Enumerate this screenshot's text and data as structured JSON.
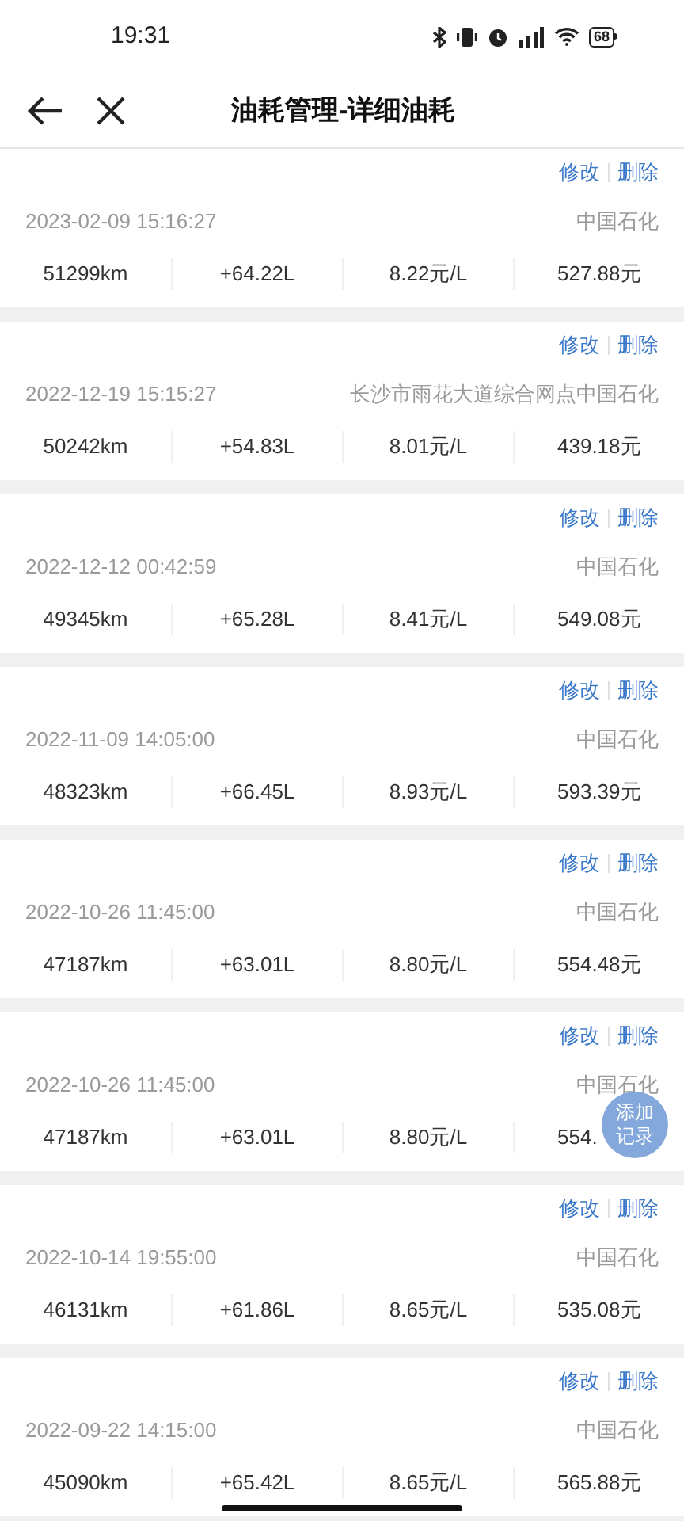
{
  "status_bar": {
    "time": "19:31",
    "battery": "68"
  },
  "nav": {
    "title": "油耗管理-详细油耗"
  },
  "records": [
    {
      "edit": "修改",
      "delete": "删除",
      "datetime": "2023-02-09 15:16:27",
      "station": "中国石化",
      "mileage": "51299km",
      "volume": "+64.22L",
      "price": "8.22元/L",
      "amount": "527.88元"
    },
    {
      "edit": "修改",
      "delete": "删除",
      "datetime": "2022-12-19 15:15:27",
      "station": "长沙市雨花大道综合网点中国石化",
      "mileage": "50242km",
      "volume": "+54.83L",
      "price": "8.01元/L",
      "amount": "439.18元"
    },
    {
      "edit": "修改",
      "delete": "删除",
      "datetime": "2022-12-12 00:42:59",
      "station": "中国石化",
      "mileage": "49345km",
      "volume": "+65.28L",
      "price": "8.41元/L",
      "amount": "549.08元"
    },
    {
      "edit": "修改",
      "delete": "删除",
      "datetime": "2022-11-09 14:05:00",
      "station": "中国石化",
      "mileage": "48323km",
      "volume": "+66.45L",
      "price": "8.93元/L",
      "amount": "593.39元"
    },
    {
      "edit": "修改",
      "delete": "删除",
      "datetime": "2022-10-26 11:45:00",
      "station": "中国石化",
      "mileage": "47187km",
      "volume": "+63.01L",
      "price": "8.80元/L",
      "amount": "554.48元"
    },
    {
      "edit": "修改",
      "delete": "删除",
      "datetime": "2022-10-26 11:45:00",
      "station": "中国石化",
      "mileage": "47187km",
      "volume": "+63.01L",
      "price": "8.80元/L",
      "amount": "554."
    },
    {
      "edit": "修改",
      "delete": "删除",
      "datetime": "2022-10-14 19:55:00",
      "station": "中国石化",
      "mileage": "46131km",
      "volume": "+61.86L",
      "price": "8.65元/L",
      "amount": "535.08元"
    },
    {
      "edit": "修改",
      "delete": "删除",
      "datetime": "2022-09-22 14:15:00",
      "station": "中国石化",
      "mileage": "45090km",
      "volume": "+65.42L",
      "price": "8.65元/L",
      "amount": "565.88元"
    }
  ],
  "fab": {
    "line_1": "添加",
    "line_2": "记录"
  }
}
